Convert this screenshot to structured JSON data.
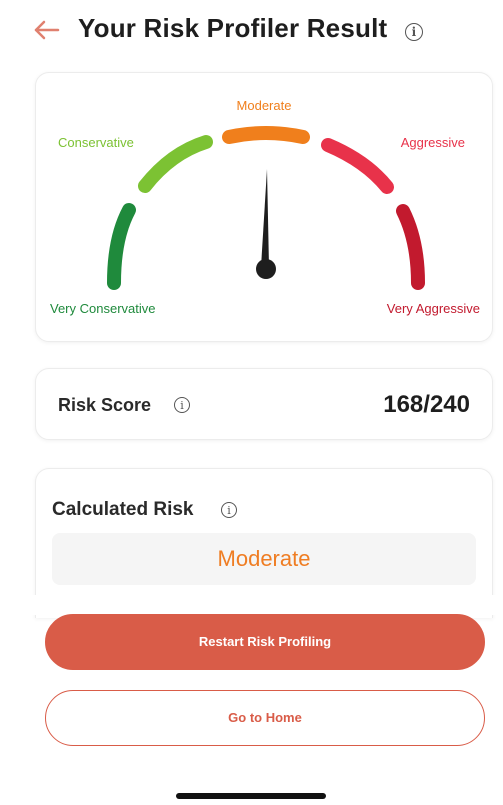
{
  "header": {
    "title": "Your Risk Profiler Result",
    "back_icon": "arrow-left-icon",
    "info_icon": "info-icon"
  },
  "gauge": {
    "labels": {
      "very_conservative": "Very Conservative",
      "conservative": "Conservative",
      "moderate": "Moderate",
      "aggressive": "Aggressive",
      "very_aggressive": "Very Aggressive"
    },
    "selected": "Moderate",
    "colors": {
      "very_conservative": "#1f8a3c",
      "conservative": "#7cc233",
      "moderate": "#f07f1c",
      "aggressive": "#e8324a",
      "very_aggressive": "#c21a2e",
      "needle": "#1e1e1e"
    }
  },
  "risk_score": {
    "label": "Risk Score",
    "value": "168/240"
  },
  "calculated_risk": {
    "label": "Calculated Risk",
    "value": "Moderate"
  },
  "buttons": {
    "restart": "Restart Risk Profiling",
    "home": "Go to Home"
  },
  "accent_color": "#d95c48"
}
